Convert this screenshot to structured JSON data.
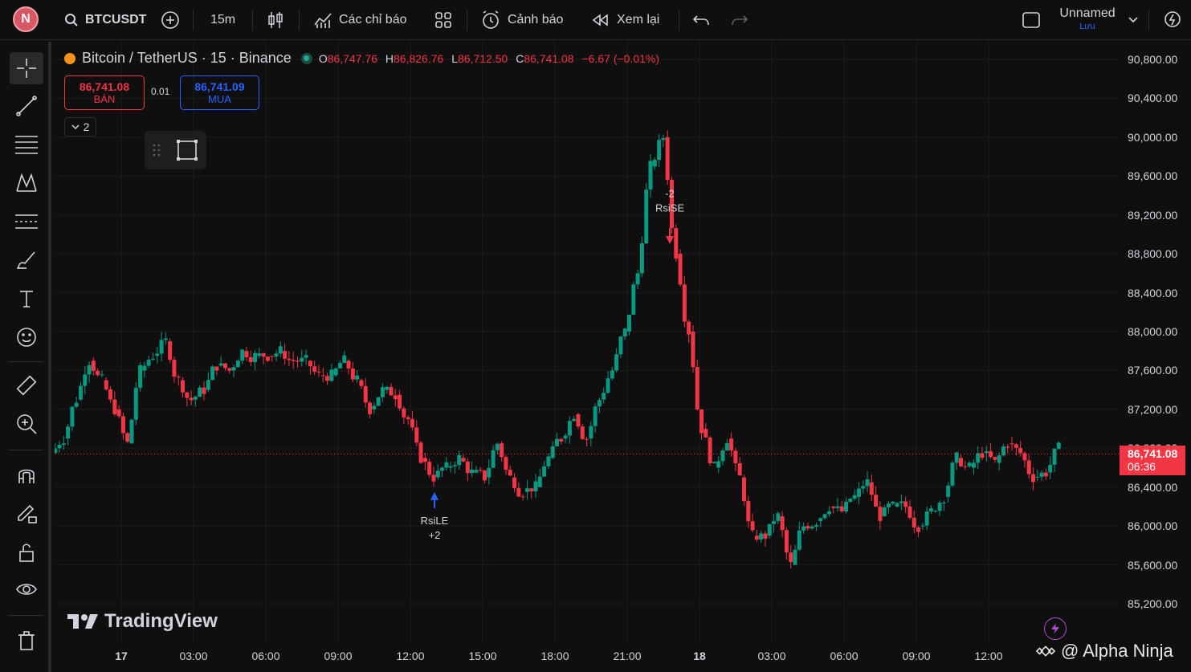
{
  "topbar": {
    "avatar": "N",
    "symbol": "BTCUSDT",
    "interval": "15m",
    "indicators": "Các chỉ báo",
    "alert": "Cảnh báo",
    "replay": "Xem lại",
    "layout_name": "Unnamed",
    "save_label": "Lưu"
  },
  "legend": {
    "title": "Bitcoin / TetherUS · 15 · Binance",
    "o_label": "O",
    "o": "86,747.76",
    "h_label": "H",
    "h": "86,826.76",
    "l_label": "L",
    "l": "86,712.50",
    "c_label": "C",
    "c": "86,741.08",
    "change": "−6.67 (−0.01%)"
  },
  "trade": {
    "sell_price": "86,741.08",
    "sell_label": "BÁN",
    "spread": "0.01",
    "buy_price": "86,741.09",
    "buy_label": "MUA",
    "indicator_count": "2"
  },
  "price_axis": {
    "labels": [
      "90,800.00",
      "90,400.00",
      "90,000.00",
      "89,600.00",
      "89,200.00",
      "88,800.00",
      "88,400.00",
      "88,000.00",
      "87,600.00",
      "87,200.00",
      "86,800.00",
      "86,400.00",
      "86,000.00",
      "85,600.00",
      "85,200.00"
    ],
    "last_price": "86,741.08",
    "countdown": "06:36"
  },
  "time_axis": {
    "labels": [
      "17",
      "03:00",
      "06:00",
      "09:00",
      "12:00",
      "15:00",
      "18:00",
      "21:00",
      "18",
      "03:00",
      "06:00",
      "09:00",
      "12:00"
    ]
  },
  "signals": {
    "long_label": "RsiLE",
    "long_qty": "+2",
    "short_label": "RsiSE",
    "short_qty": "-2"
  },
  "branding": {
    "tradingview": "TradingView",
    "watermark": "@ Alpha Ninja"
  },
  "colors": {
    "up": "#089981",
    "down": "#f23645",
    "buy": "#2962ff",
    "background": "#0f0f0f"
  },
  "chart_data": {
    "type": "candlestick",
    "ylim": [
      85000,
      91000
    ],
    "close_series_approx": [
      86900,
      87300,
      87700,
      87500,
      87200,
      86850,
      87600,
      87750,
      87900,
      87500,
      87300,
      87400,
      87650,
      87600,
      87800,
      87750,
      87750,
      87800,
      87700,
      87700,
      87550,
      87550,
      87700,
      87500,
      87200,
      87400,
      87350,
      87100,
      86700,
      86500,
      86600,
      86700,
      86550,
      86500,
      86850,
      86500,
      86350,
      86400,
      86700,
      86900,
      87150,
      86900,
      87300,
      87600,
      88000,
      88600,
      89700,
      90000,
      88800,
      88000,
      87000,
      86600,
      86900,
      86500,
      85900,
      85900,
      86100,
      85600,
      86000,
      86050,
      86200,
      86150,
      86300,
      86450,
      86100,
      86200,
      86200,
      86000,
      86150,
      86300,
      86700,
      86600,
      86750,
      86650,
      86850,
      86750,
      86500,
      86550,
      86800
    ]
  }
}
